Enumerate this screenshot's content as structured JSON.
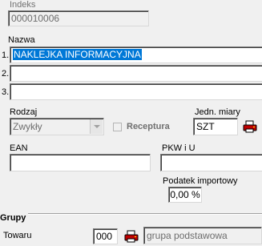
{
  "indeks": {
    "label": "Indeks",
    "value": "000010006"
  },
  "nazwa": {
    "label": "Nazwa",
    "lines": [
      {
        "num": "1.",
        "value": "NAKLEJKA INFORMACYJNA"
      },
      {
        "num": "2.",
        "value": ""
      },
      {
        "num": "3.",
        "value": ""
      }
    ]
  },
  "rodzaj": {
    "label": "Rodzaj",
    "value": "Zwykły"
  },
  "receptura": {
    "label": "Receptura",
    "checked": false
  },
  "jedn_miary": {
    "label": "Jedn. miary",
    "value": "SZT",
    "icon": "printer-icon"
  },
  "ean": {
    "label": "EAN",
    "value": ""
  },
  "pkwiu": {
    "label": "PKW i U",
    "value": ""
  },
  "podatek": {
    "label": "Podatek importowy",
    "value": "0,00 %"
  },
  "grupy": {
    "title": "Grupy",
    "towaru_label": "Towaru",
    "code": "000",
    "icon": "printer-icon",
    "name": "grupa podstawowa"
  }
}
